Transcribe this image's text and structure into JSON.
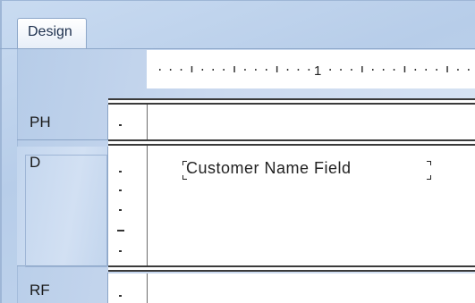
{
  "tabs": [
    {
      "label": "Design"
    }
  ],
  "ruler": {
    "mark_label": "1"
  },
  "bands": [
    {
      "label": "PH"
    },
    {
      "label": "D"
    },
    {
      "label": "RF"
    }
  ],
  "field": {
    "label": "Customer Name Field"
  }
}
